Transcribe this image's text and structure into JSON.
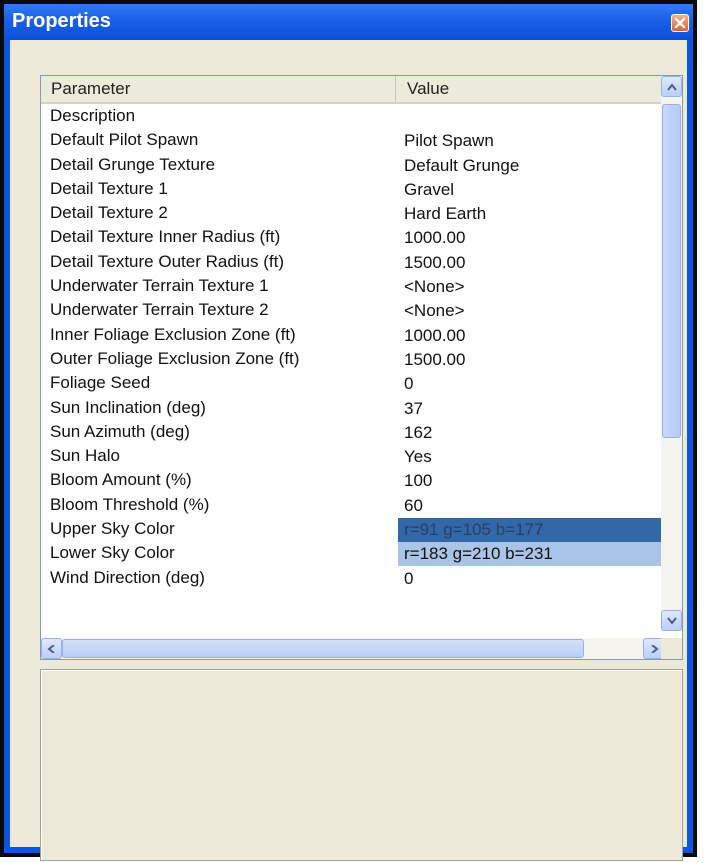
{
  "window": {
    "title": "Properties"
  },
  "grid": {
    "columns": {
      "parameter": "Parameter",
      "value": "Value"
    },
    "rows": [
      {
        "parameter": "Description",
        "value": ""
      },
      {
        "parameter": "Default Pilot Spawn",
        "value": "Pilot Spawn"
      },
      {
        "parameter": "Detail Grunge Texture",
        "value": "Default Grunge"
      },
      {
        "parameter": "Detail Texture 1",
        "value": "Gravel"
      },
      {
        "parameter": "Detail Texture 2",
        "value": "Hard Earth"
      },
      {
        "parameter": "Detail Texture Inner Radius (ft)",
        "value": "1000.00"
      },
      {
        "parameter": "Detail Texture Outer Radius (ft)",
        "value": "1500.00"
      },
      {
        "parameter": "Underwater Terrain Texture 1",
        "value": "<None>"
      },
      {
        "parameter": "Underwater Terrain Texture 2",
        "value": "<None>"
      },
      {
        "parameter": "Inner Foliage Exclusion Zone (ft)",
        "value": "1000.00"
      },
      {
        "parameter": "Outer Foliage Exclusion Zone (ft)",
        "value": "1500.00"
      },
      {
        "parameter": "Foliage Seed",
        "value": "0"
      },
      {
        "parameter": "Sun Inclination (deg)",
        "value": "37"
      },
      {
        "parameter": "Sun Azimuth (deg)",
        "value": "162"
      },
      {
        "parameter": "Sun Halo",
        "value": "Yes"
      },
      {
        "parameter": "Bloom Amount (%)",
        "value": "100"
      },
      {
        "parameter": "Bloom Threshold (%)",
        "value": "60"
      },
      {
        "parameter": "Upper Sky Color",
        "value": "r=91 g=105 b=177",
        "swatch": "#3368a8"
      },
      {
        "parameter": "Lower Sky Color",
        "value": "r=183 g=210 b=231",
        "swatch": "#a9c4e6"
      },
      {
        "parameter": "Wind Direction (deg)",
        "value": "0"
      }
    ]
  },
  "description_panel": {
    "text": ""
  },
  "colors": {
    "titlebar": "#0c4fd8",
    "client": "#ece9d8",
    "selection": "#3368a8"
  },
  "icons": {
    "close": "close-icon",
    "up": "arrow-up-icon",
    "down": "arrow-down-icon",
    "left": "arrow-left-icon",
    "right": "arrow-right-icon"
  }
}
